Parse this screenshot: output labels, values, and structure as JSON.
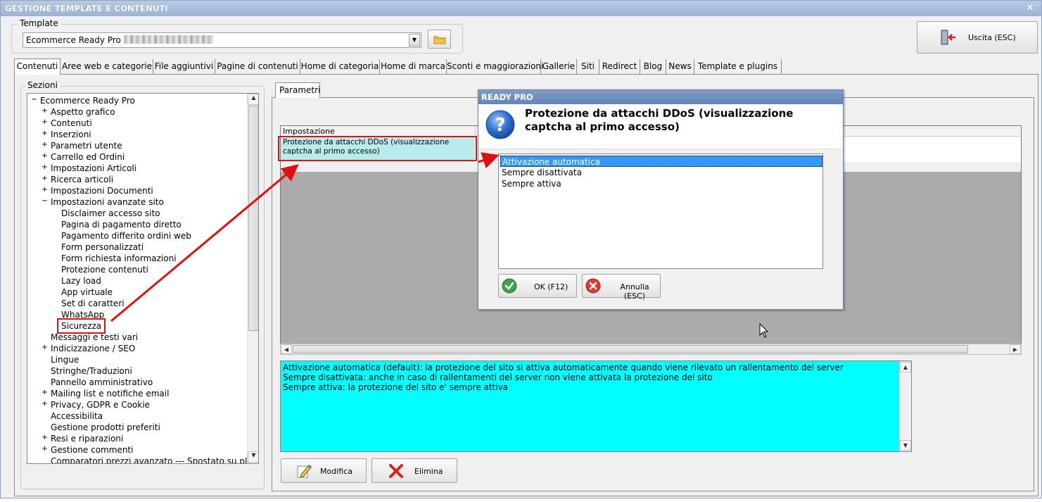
{
  "app": {
    "title": "GESTIONE TEMPLATE E CONTENUTI",
    "close_glyph": "✕"
  },
  "template_group": {
    "label": "Template",
    "combo_value": "Ecommerce Ready Pro",
    "combo_arrow": "▼",
    "folder_icon": "folder-icon"
  },
  "exit_button": {
    "label": "Uscita (ESC)",
    "icon": "exit-door-icon"
  },
  "tabs": [
    {
      "label": "Contenuti",
      "active": true
    },
    {
      "label": "Aree web e categorie"
    },
    {
      "label": "File aggiuntivi"
    },
    {
      "label": "Pagine di contenuti"
    },
    {
      "label": "Home di categoria"
    },
    {
      "label": "Home di marca"
    },
    {
      "label": "Sconti e maggiorazioni"
    },
    {
      "label": "Gallerie"
    },
    {
      "label": "Siti"
    },
    {
      "label": "Redirect"
    },
    {
      "label": "Blog"
    },
    {
      "label": "News"
    },
    {
      "label": "Template e plugins"
    }
  ],
  "sections": {
    "label": "Sezioni",
    "tree": [
      {
        "label": "Ecommerce Ready Pro",
        "level": 0,
        "expander": "⊟"
      },
      {
        "label": "Aspetto grafico",
        "level": 1,
        "expander": "⊞"
      },
      {
        "label": "Contenuti",
        "level": 1,
        "expander": "⊞"
      },
      {
        "label": "Inserzioni",
        "level": 1,
        "expander": "⊞"
      },
      {
        "label": "Parametri utente",
        "level": 1,
        "expander": "⊞"
      },
      {
        "label": "Carrello ed Ordini",
        "level": 1,
        "expander": "⊞"
      },
      {
        "label": "Impostazioni Articoli",
        "level": 1,
        "expander": "⊞"
      },
      {
        "label": "Ricerca articoli",
        "level": 1,
        "expander": "⊞"
      },
      {
        "label": "Impostazioni Documenti",
        "level": 1,
        "expander": "⊞"
      },
      {
        "label": "Impostazioni avanzate sito",
        "level": 1,
        "expander": "⊟"
      },
      {
        "label": "Disclaimer accesso sito",
        "level": 2
      },
      {
        "label": "Pagina di pagamento diretto",
        "level": 2
      },
      {
        "label": "Pagamento differito ordini web",
        "level": 2
      },
      {
        "label": "Form personalizzati",
        "level": 2
      },
      {
        "label": "Form richiesta informazioni",
        "level": 2
      },
      {
        "label": "Protezione contenuti",
        "level": 2
      },
      {
        "label": "Lazy load",
        "level": 2
      },
      {
        "label": "App virtuale",
        "level": 2
      },
      {
        "label": "Set di caratteri",
        "level": 2
      },
      {
        "label": "WhatsApp",
        "level": 2
      },
      {
        "label": "Sicurezza",
        "level": 2,
        "highlight": true
      },
      {
        "label": "Messaggi e testi vari",
        "level": 1
      },
      {
        "label": "Indicizzazione / SEO",
        "level": 1,
        "expander": "⊞"
      },
      {
        "label": "Lingue",
        "level": 1
      },
      {
        "label": "Stringhe/Traduzioni",
        "level": 1
      },
      {
        "label": "Pannello amministrativo",
        "level": 1
      },
      {
        "label": "Mailing list e notifiche email",
        "level": 1,
        "expander": "⊞"
      },
      {
        "label": "Privacy, GDPR e Cookie",
        "level": 1,
        "expander": "⊞"
      },
      {
        "label": "Accessibilita",
        "level": 1
      },
      {
        "label": "Gestione prodotti preferiti",
        "level": 1
      },
      {
        "label": "Resi e riparazioni",
        "level": 1,
        "expander": "⊞"
      },
      {
        "label": "Gestione commenti",
        "level": 1,
        "expander": "⊞"
      },
      {
        "label": "Comparatori prezzi avanzato --- Spostato su plugins",
        "level": 1
      }
    ]
  },
  "params": {
    "tab_label": "Parametri",
    "col_header": "Impostazione",
    "row_text": "Protezione da attacchi DDoS (visualizzazione captcha al primo accesso)"
  },
  "info_text": [
    "Attivazione automatica (default): la protezione del sito si attiva automaticamente quando viene rilevato un rallentamento del server",
    "Sempre disattivata: anche in caso di rallentamenti del server non viene attivata la protezione del sito",
    "Sempre attiva: la protezione del sito e' sempre attiva"
  ],
  "bottom_buttons": {
    "modify": "Modifica",
    "delete": "Elimina"
  },
  "dialog": {
    "title": "READY PRO",
    "question": "Protezione da attacchi DDoS (visualizzazione captcha al primo accesso)",
    "options": [
      "Attivazione automatica",
      "Sempre disattivata",
      "Sempre attiva"
    ],
    "selected_index": 0,
    "ok_label": "OK (F12)",
    "cancel_label": "Annulla (ESC)"
  },
  "scroll": {
    "up": "▲",
    "down": "▼",
    "left": "◀",
    "right": "▶"
  },
  "colors": {
    "info_bg": "#00ffff",
    "row_highlight": "#b8ecec",
    "annotation_red": "#e01010",
    "selection_blue": "#3399ff"
  }
}
